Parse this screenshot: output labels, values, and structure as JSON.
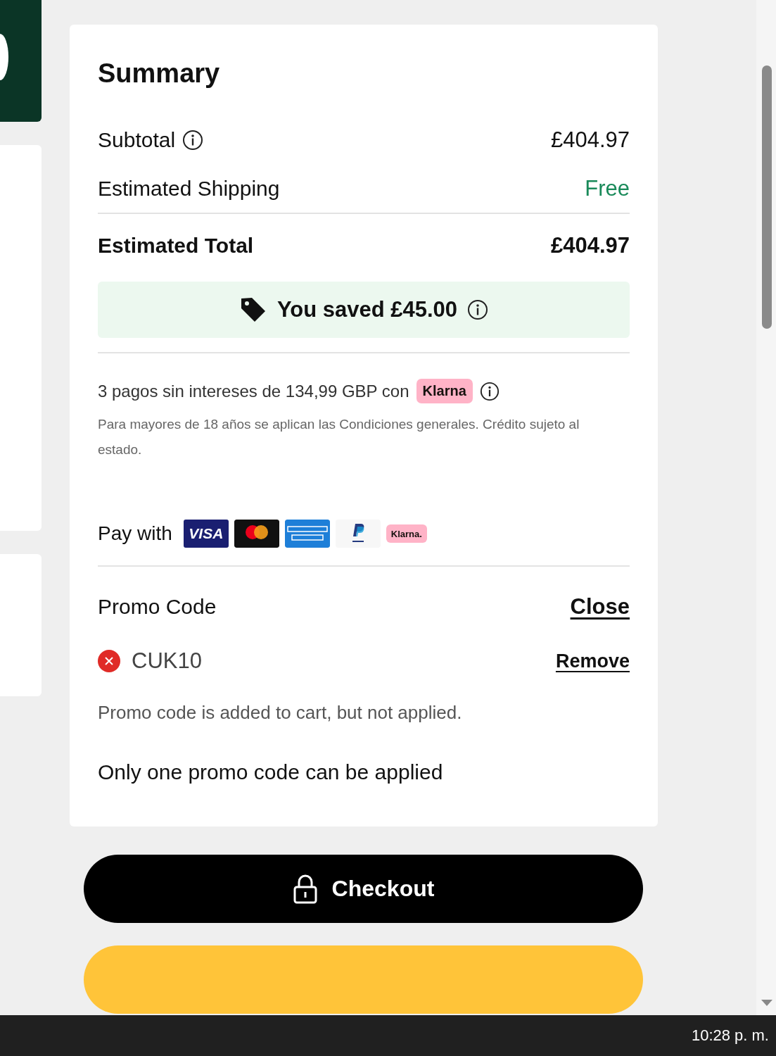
{
  "summary": {
    "title": "Summary",
    "rows": [
      {
        "kind": "line",
        "label": "Subtotal",
        "info": true,
        "value": "£404.97",
        "positive": false
      },
      {
        "kind": "line",
        "label": "Estimated Shipping",
        "info": false,
        "value": "Free",
        "positive": true
      },
      {
        "kind": "total",
        "label": "Estimated Total",
        "info": false,
        "value": "£404.97",
        "positive": false
      }
    ],
    "savings": {
      "text": "You saved £45.00",
      "info": true
    },
    "installments": {
      "text": "3 pagos sin intereses de 134,99 GBP con",
      "provider": "Klarna",
      "info": true,
      "disclaimer": "Para mayores de 18 años se aplican las Condiciones generales. Crédito sujeto al estado."
    },
    "pay_with": {
      "label": "Pay with",
      "methods": [
        {
          "kind": "visa",
          "label": "VISA"
        },
        {
          "kind": "mastercard"
        },
        {
          "kind": "amex"
        },
        {
          "kind": "paypal"
        },
        {
          "kind": "klarna",
          "label": "Klarna."
        }
      ]
    },
    "promo": {
      "title": "Promo Code",
      "toggle": "Close",
      "code": "CUK10",
      "applied": false,
      "remove": "Remove",
      "message": "Promo code is added to cart, but not applied.",
      "note": "Only one promo code can be applied"
    }
  },
  "checkout_button": {
    "label": "Checkout"
  },
  "taskbar": {
    "clock": "10:28 p. m."
  }
}
